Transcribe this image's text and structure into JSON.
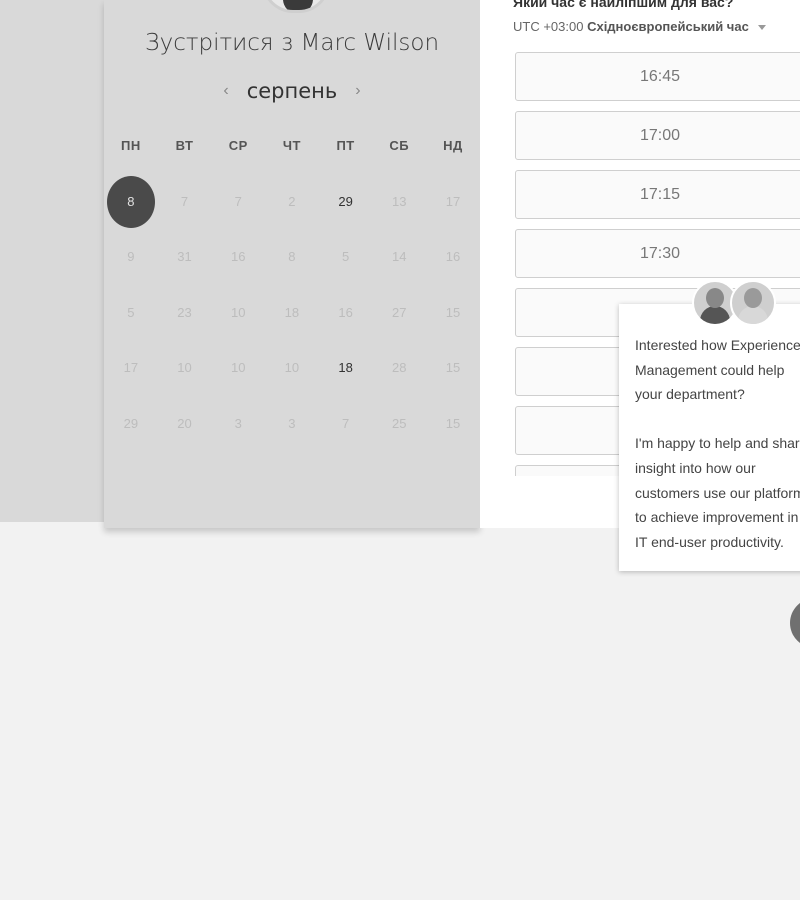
{
  "scheduler": {
    "title_prefix": "Зустрітися з",
    "host_name": "Marc Wilson",
    "month": "серпень",
    "prev_arrow": "‹",
    "next_arrow": "›",
    "weekdays": [
      "ПН",
      "ВТ",
      "СР",
      "ЧТ",
      "ПТ",
      "СБ",
      "НД"
    ],
    "days": [
      [
        "8",
        "7",
        "7",
        "2",
        "29",
        "13",
        "17"
      ],
      [
        "9",
        "31",
        "16",
        "8",
        "5",
        "14",
        "16"
      ],
      [
        "5",
        "23",
        "10",
        "18",
        "16",
        "27",
        "15"
      ],
      [
        "17",
        "10",
        "10",
        "10",
        "18",
        "28",
        "15"
      ],
      [
        "29",
        "20",
        "3",
        "3",
        "7",
        "25",
        "15"
      ]
    ],
    "selected_day": "8",
    "available_days": [
      "29",
      "18"
    ]
  },
  "times": {
    "question": "Який час є найліпшим для вас?",
    "timezone_offset": "UTC +03:00",
    "timezone_name": "Східноєвропейський час",
    "slots": [
      "16:45",
      "17:00",
      "17:15",
      "17:30",
      "",
      "",
      "",
      ""
    ]
  },
  "chat": {
    "message": "Interested how Experience Management could help your department?\n\nI'm happy to help and share insight into how our customers use our platform to achieve improvement in IT end-user productivity."
  }
}
